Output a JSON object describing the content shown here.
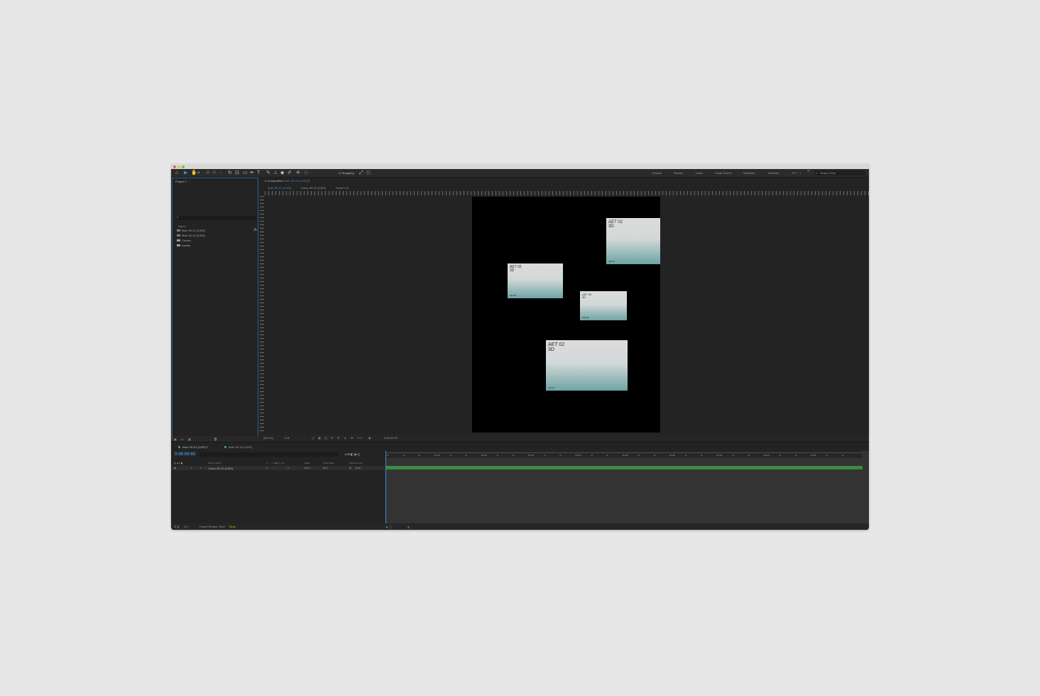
{
  "toolbar": {
    "snapping_label": "Snapping",
    "workspaces": [
      "Default",
      "Review",
      "Learn",
      "Small Screen",
      "Standard",
      "Libraries",
      "AET"
    ],
    "active_workspace": "AET",
    "search_placeholder": "Search Help"
  },
  "project": {
    "title": "Project",
    "list_header": "Name",
    "items": [
      "Main 3D 01 [1330]",
      "Main 3D 02 [1330]",
      "Comps",
      "Assets"
    ]
  },
  "composition": {
    "tab_prefix": "Composition",
    "tab_name": "Main 3D 01 [1330]",
    "breadcrumbs": [
      "Main 3D 01 [1330]",
      "Comp 3D 02 [1303]",
      "Screen 01"
    ],
    "cards": [
      {
        "title": "AET 02\n3D",
        "tag": "AET02"
      },
      {
        "title": "AET 02\n3D",
        "tag": "AET02"
      },
      {
        "title": "AET 02\n3D",
        "tag": "AET02"
      },
      {
        "title": "AET 02\n3D",
        "tag": "AET02"
      }
    ],
    "footer": {
      "zoom": "(66.1%)",
      "resolution": "Full",
      "value_label": "+0.0",
      "timecode": "0:00:00:00"
    }
  },
  "timeline": {
    "tabs": [
      "Main 3D 02 [1330]",
      "Main 3D 01 [1330]"
    ],
    "timecode": "0:00:00:00",
    "columns": [
      "Source Name",
      "Mode",
      "Track Matte",
      "Parent & Link"
    ],
    "layer": {
      "index": "1",
      "name": "Comp 3D 01 [1330]",
      "mode": "Norm",
      "matte": "No A",
      "parent": "None"
    },
    "ruler_ticks": [
      "0f",
      "1f",
      "2f",
      "01:00f",
      "1f",
      "2f",
      "02:00f",
      "1f",
      "2f",
      "03:00f",
      "1f",
      "2f",
      "04:00f",
      "1f",
      "2f",
      "05:00f",
      "1f",
      "2f",
      "06:00f",
      "1f",
      "2f",
      "07:00f",
      "1f",
      "2f",
      "08:00f",
      "1f",
      "2f",
      "09:00f",
      "1f",
      "2f"
    ],
    "status": {
      "render_label": "Frame Render Time:",
      "render_value": "76ms"
    }
  },
  "colors": {
    "accent": "#3b8cd6",
    "layer_bar": "#3d8a45",
    "label_green": "#3c9a48"
  }
}
